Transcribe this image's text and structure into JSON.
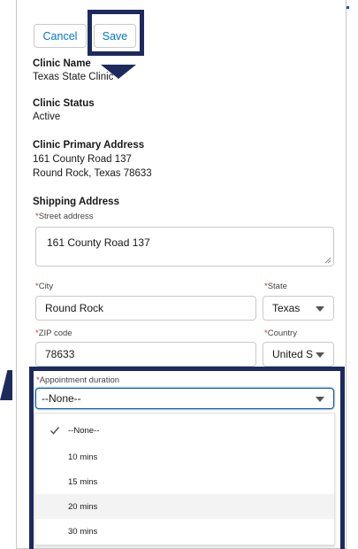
{
  "actions": {
    "cancel_label": "Cancel",
    "save_label": "Save"
  },
  "clinic_name": {
    "label": "Clinic Name",
    "value": "Texas State Clinic"
  },
  "clinic_status": {
    "label": "Clinic Status",
    "value": "Active"
  },
  "primary_address": {
    "label": "Clinic Primary Address",
    "line1": "161 County Road 137",
    "line2": "Round Rock, Texas 78633"
  },
  "shipping": {
    "section_label": "Shipping Address",
    "street": {
      "label": "Street address",
      "value": "161 County Road 137"
    },
    "city": {
      "label": "City",
      "value": "Round Rock"
    },
    "state": {
      "label": "State",
      "value": "Texas"
    },
    "zip": {
      "label": "ZIP code",
      "value": "78633"
    },
    "country": {
      "label": "Country",
      "value": "United S"
    }
  },
  "appointment": {
    "label": "Appointment duration",
    "selected": "--None--",
    "options": [
      "--None--",
      "10 mins",
      "15 mins",
      "20 mins",
      "30 mins"
    ]
  },
  "required_marker": "*",
  "colors": {
    "link": "#0176d3",
    "highlight": "#1e2a5e",
    "required": "#c23934"
  }
}
